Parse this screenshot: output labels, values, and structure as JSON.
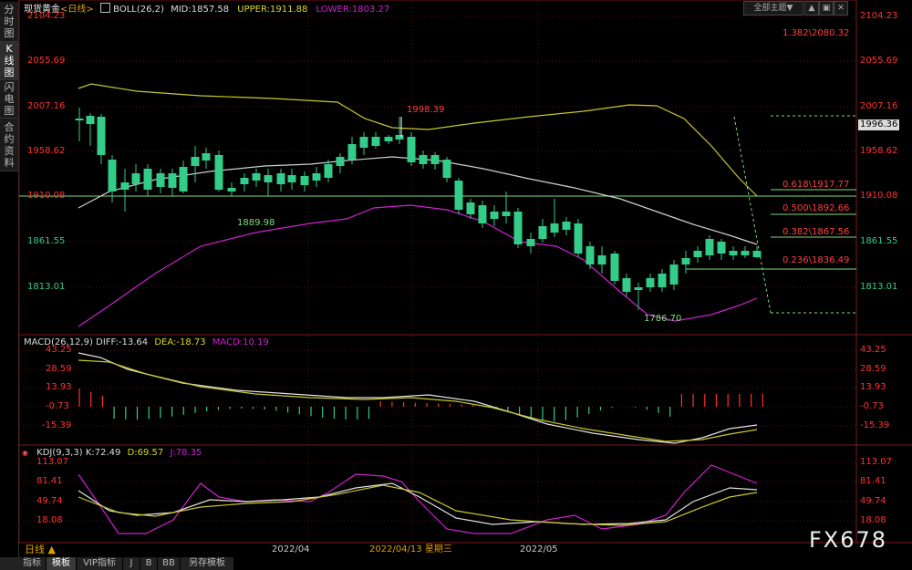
{
  "sidebar_tabs": [
    {
      "label": "分时图",
      "active": false
    },
    {
      "label": "K线图",
      "active": true
    },
    {
      "label": "闪电图",
      "active": false
    },
    {
      "label": "合约资料",
      "active": false
    }
  ],
  "toolbar": {
    "theme_label": "全部主题▼",
    "btn1": "▲",
    "btn2": "▣",
    "btn3": "✕"
  },
  "price_panel": {
    "instrument": "现货黄金",
    "period": "<日线>",
    "indicator_name": "BOLL(26,2)",
    "mid": "MID:1857.58",
    "upper": "UPPER:1911.88",
    "lower": "LOWER:1803.27",
    "axis_labels": [
      "2104.23",
      "2055.69",
      "2007.16",
      "1958.62",
      "1910.08",
      "1861.55",
      "1813.01"
    ],
    "current_price": "1996.36",
    "high_label": "1998.39",
    "low_label": "1786.70",
    "swing_label": "1889.98",
    "fib": [
      {
        "ratio": "1.382",
        "value": "2080.32"
      },
      {
        "ratio": "0.618",
        "value": "1917.77"
      },
      {
        "ratio": "0.500",
        "value": "1892.66"
      },
      {
        "ratio": "0.382",
        "value": "1867.56"
      },
      {
        "ratio": "0.236",
        "value": "1836.49"
      }
    ]
  },
  "macd_panel": {
    "indicator_name": "MACD(26,12,9)",
    "diff": "DIFF:-13.64",
    "dea": "DEA:-18.73",
    "macd": "MACD:10.19",
    "axis_labels": [
      "43.25",
      "28.59",
      "13.93",
      "-0.73",
      "-15.39"
    ]
  },
  "kdj_panel": {
    "indicator_name": "KDJ(9,3,3)",
    "k": "K:72.49",
    "d": "D:69.57",
    "j": "J:78.35",
    "axis_labels": [
      "113.07",
      "81.41",
      "49.74",
      "18.08"
    ]
  },
  "time_axis": {
    "labels": [
      "2022/04",
      "2022/04/13 星期三",
      "2022/05"
    ]
  },
  "period_selector": "日线 ▲",
  "bottom_tabs": [
    {
      "label": "指标",
      "active": false
    },
    {
      "label": "模板",
      "active": true
    },
    {
      "label": "VIP指标",
      "active": false
    },
    {
      "label": "J",
      "active": false
    },
    {
      "label": "B",
      "active": false
    },
    {
      "label": "BB",
      "active": false
    },
    {
      "label": "另存模板",
      "active": false
    }
  ],
  "watermark": "FX678",
  "colors": {
    "up": "#ff3232",
    "down": "#33cc88",
    "boll_upper": "#c8c82a",
    "boll_mid": "#cfcfcf",
    "boll_lower": "#d020d0",
    "fib_label": "#ff3333",
    "grid": "#7a1a1a"
  }
}
